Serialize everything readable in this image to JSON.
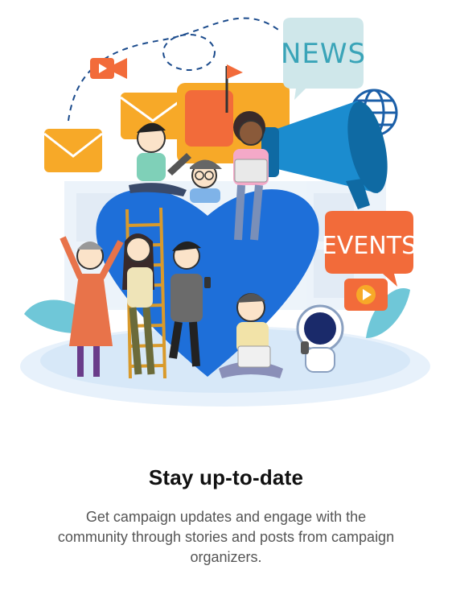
{
  "onboarding": {
    "title": "Stay up-to-date",
    "description": "Get campaign updates and engage with the community through stories and posts from campaign organizers.",
    "illustration": {
      "news_label": "NEWS",
      "events_label": "EVENTS",
      "icons": [
        "video-camera-icon",
        "envelope-icon",
        "globe-icon",
        "megaphone-icon",
        "play-icon",
        "flag-icon",
        "heart-icon"
      ]
    },
    "colors": {
      "heart": "#1e6fd9",
      "megaphone": "#1b8ccf",
      "accent_orange": "#f26b3a",
      "accent_yellow": "#f7a928",
      "title": "#111111",
      "body": "#555555"
    }
  }
}
